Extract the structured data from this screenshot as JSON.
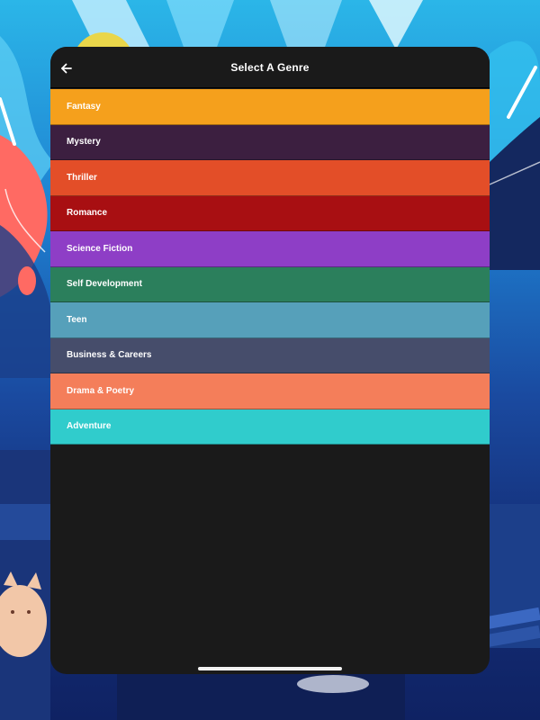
{
  "header": {
    "title": "Select A Genre"
  },
  "genres": [
    {
      "label": "Fantasy",
      "color": "#f5a01c"
    },
    {
      "label": "Mystery",
      "color": "#3c1f40"
    },
    {
      "label": "Thriller",
      "color": "#e34e28"
    },
    {
      "label": "Romance",
      "color": "#a80f12"
    },
    {
      "label": "Science Fiction",
      "color": "#8e3ec6"
    },
    {
      "label": "Self Development",
      "color": "#2b7f5c"
    },
    {
      "label": "Teen",
      "color": "#56a0ba"
    },
    {
      "label": "Business & Careers",
      "color": "#464d6b"
    },
    {
      "label": "Drama & Poetry",
      "color": "#f47e5a"
    },
    {
      "label": "Adventure",
      "color": "#30cccc"
    }
  ],
  "icons": {
    "back": "arrow-left-icon"
  },
  "colors": {
    "panel": "#1a1a1a",
    "header_text": "#ffffff",
    "background_top": "#2bb6e8",
    "background_bottom": "#0f2263"
  }
}
